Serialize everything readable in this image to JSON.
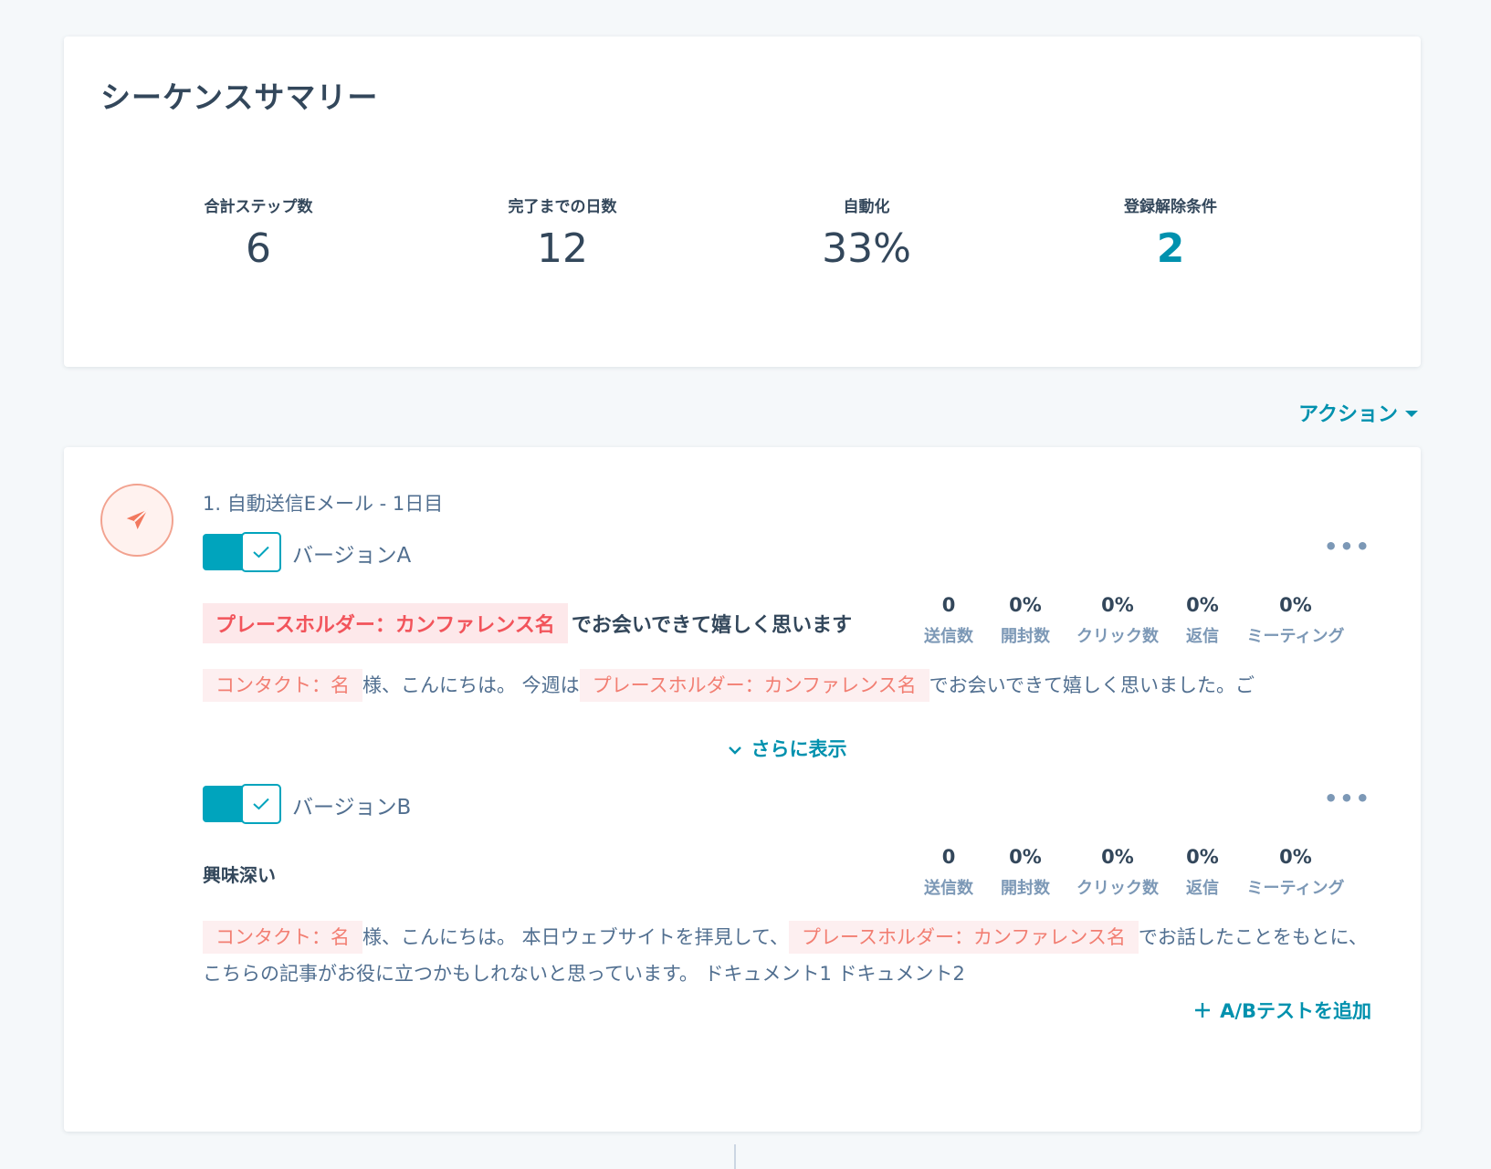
{
  "summary": {
    "title": "シーケンスサマリー",
    "stats": [
      {
        "label": "合計ステップ数",
        "value": "6"
      },
      {
        "label": "完了までの日数",
        "value": "12"
      },
      {
        "label": "自動化",
        "value": "33%"
      },
      {
        "label": "登録解除条件",
        "value": "2"
      }
    ]
  },
  "actions": {
    "label": "アクション"
  },
  "step": {
    "title": "1. 自動送信Eメール - 1日目",
    "icon": "paper-plane-icon",
    "metric_labels": [
      "送信数",
      "開封数",
      "クリック数",
      "返信",
      "ミーティング"
    ],
    "versions": [
      {
        "name": "バージョンA",
        "subject_token": "プレースホルダー：カンファレンス名",
        "subject_text": "でお会いできて嬉しく思います",
        "metrics": [
          "0",
          "0%",
          "0%",
          "0%",
          "0%"
        ],
        "body": {
          "token1": "コンタクト：名",
          "text1": "様、こんにちは。 今週は",
          "token2": "プレースホルダー：カンファレンス名",
          "text2": "でお会いできて嬉しく思いました。ご"
        }
      },
      {
        "name": "バージョンB",
        "subject_text": "興味深い",
        "metrics": [
          "0",
          "0%",
          "0%",
          "0%",
          "0%"
        ],
        "body": {
          "token1": "コンタクト：名",
          "text1": "様、こんにちは。 本日ウェブサイトを拝見して、",
          "token2": "プレースホルダー：カンファレンス名",
          "text2": "でお話したことをもとに、こちらの記事がお役に立つかもしれないと思っています。 ドキュメント1 ドキュメント2"
        }
      }
    ],
    "show_more": "さらに表示",
    "add_ab": "A/Bテストを追加"
  },
  "colors": {
    "accent": "#0091ae",
    "toggle": "#00a4bd",
    "token_text": "#f2545b",
    "token_bg": "#fde8ea"
  }
}
